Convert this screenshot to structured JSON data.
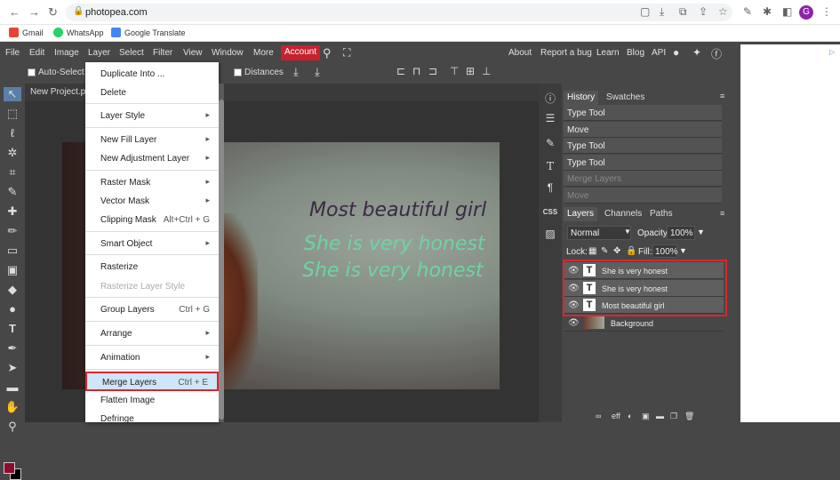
{
  "browser": {
    "url": "photopea.com",
    "profile_initial": "G",
    "bookmarks": [
      {
        "label": "Gmail",
        "color": "#ea4335"
      },
      {
        "label": "WhatsApp",
        "color": "#25d366"
      },
      {
        "label": "Google Translate",
        "color": "#4285f4"
      }
    ]
  },
  "menubar": {
    "items": [
      "File",
      "Edit",
      "Image",
      "Layer",
      "Select",
      "Filter",
      "View",
      "Window",
      "More"
    ],
    "account": "Account",
    "right_items": [
      "About",
      "Report a bug",
      "Learn",
      "Blog",
      "API"
    ]
  },
  "options": {
    "auto_select": "Auto-Select",
    "distances": "Distances"
  },
  "document": {
    "tab": "New Project.psd"
  },
  "layer_menu": [
    {
      "label": "Duplicate Into ...",
      "shortcut": "",
      "submenu": false,
      "disabled": false
    },
    {
      "label": "Delete",
      "shortcut": "",
      "submenu": false,
      "disabled": false
    },
    {
      "label": "Layer Style",
      "shortcut": "",
      "submenu": true,
      "disabled": false
    },
    {
      "label": "New Fill Layer",
      "shortcut": "",
      "submenu": true,
      "disabled": false
    },
    {
      "label": "New Adjustment Layer",
      "shortcut": "",
      "submenu": true,
      "disabled": false
    },
    {
      "label": "Raster Mask",
      "shortcut": "",
      "submenu": true,
      "disabled": false
    },
    {
      "label": "Vector Mask",
      "shortcut": "",
      "submenu": true,
      "disabled": false
    },
    {
      "label": "Clipping Mask",
      "shortcut": "Alt+Ctrl + G",
      "submenu": false,
      "disabled": false
    },
    {
      "label": "Smart Object",
      "shortcut": "",
      "submenu": true,
      "disabled": false
    },
    {
      "label": "Rasterize",
      "shortcut": "",
      "submenu": false,
      "disabled": false
    },
    {
      "label": "Rasterize Layer Style",
      "shortcut": "",
      "submenu": false,
      "disabled": true
    },
    {
      "label": "Group Layers",
      "shortcut": "Ctrl + G",
      "submenu": false,
      "disabled": false
    },
    {
      "label": "Arrange",
      "shortcut": "",
      "submenu": true,
      "disabled": false
    },
    {
      "label": "Animation",
      "shortcut": "",
      "submenu": true,
      "disabled": false
    },
    {
      "label": "Merge Layers",
      "shortcut": "Ctrl + E",
      "submenu": false,
      "disabled": false,
      "highlighted": true
    },
    {
      "label": "Flatten Image",
      "shortcut": "",
      "submenu": false,
      "disabled": false
    },
    {
      "label": "Defringe",
      "shortcut": "",
      "submenu": false,
      "disabled": false
    }
  ],
  "canvas_text": {
    "line1": "Most beautiful girl",
    "line2": "She is very honest",
    "line3": "She is very honest",
    "line1_color": "#3b2a45",
    "line2_color": "#6fd3a3"
  },
  "history": {
    "tabs": [
      "History",
      "Swatches"
    ],
    "items": [
      {
        "label": "Type Tool",
        "dim": false
      },
      {
        "label": "Move",
        "dim": false
      },
      {
        "label": "Type Tool",
        "dim": false
      },
      {
        "label": "Type Tool",
        "dim": false
      },
      {
        "label": "Merge Layers",
        "dim": true
      },
      {
        "label": "Move",
        "dim": true
      }
    ]
  },
  "layers": {
    "tabs": [
      "Layers",
      "Channels",
      "Paths"
    ],
    "blend_mode": "Normal",
    "opacity_label": "Opacity:",
    "opacity": "100%",
    "lock_label": "Lock:",
    "fill_label": "Fill:",
    "fill": "100%",
    "items": [
      {
        "name": "She is very honest",
        "type": "T"
      },
      {
        "name": "She is very honest",
        "type": "T"
      },
      {
        "name": "Most beautiful girl",
        "type": "T"
      },
      {
        "name": "Background",
        "type": "image"
      }
    ]
  },
  "colors": {
    "highlight_border": "#d9262f",
    "account_bg": "#c6232f",
    "foreground_swatch": "#8b0d2e",
    "background_swatch": "#000000"
  }
}
